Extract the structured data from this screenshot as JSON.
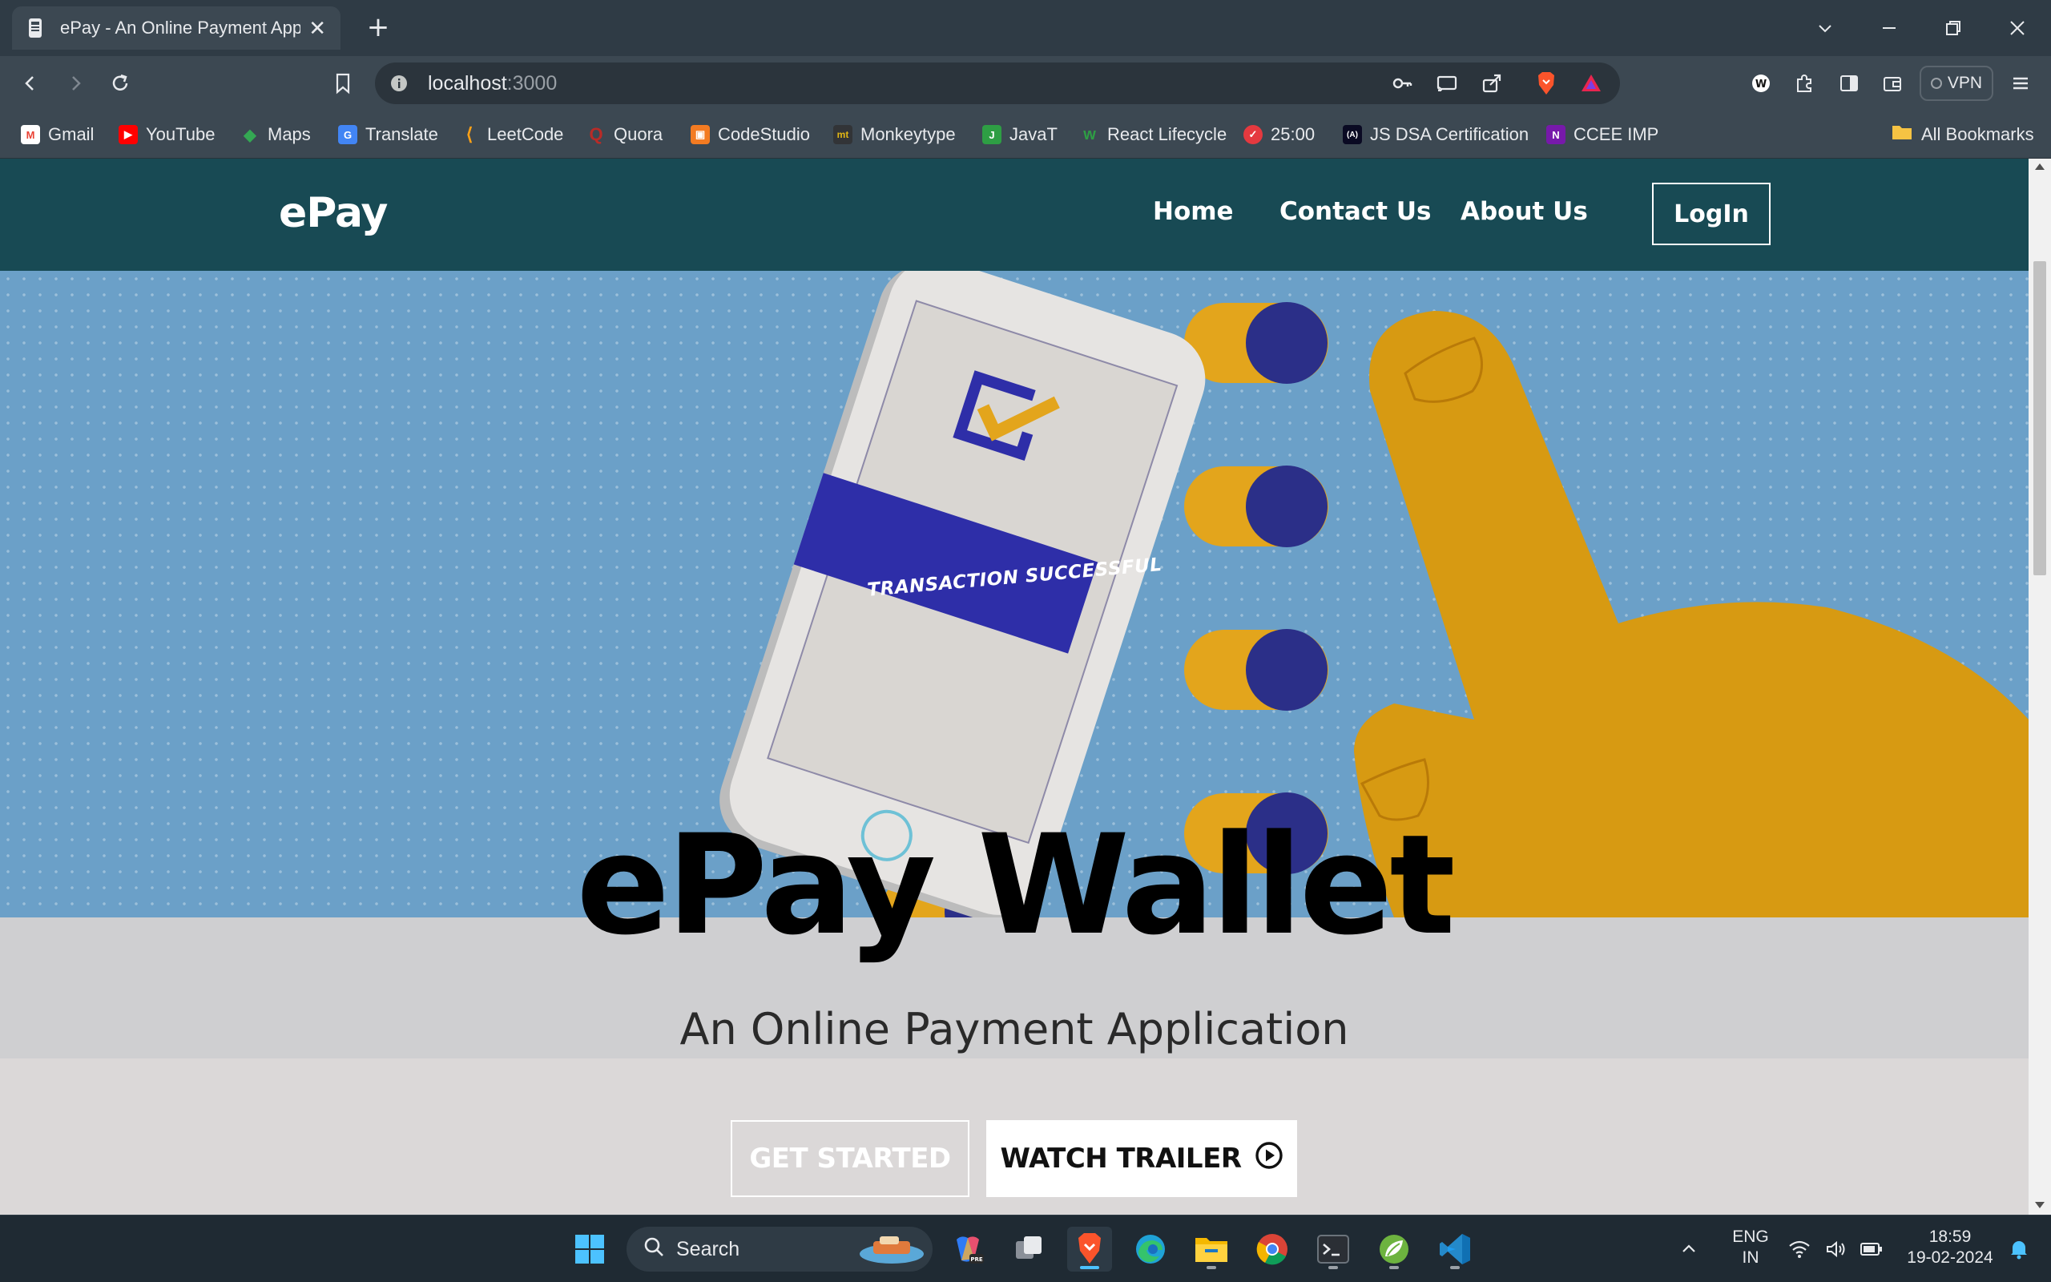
{
  "browser": {
    "tab": {
      "title": "ePay - An Online Payment App",
      "close": "✕"
    },
    "new_tab": "+",
    "url": {
      "host": "localhost",
      "port": ":3000"
    },
    "vpn_label": "VPN"
  },
  "bookmarks": [
    {
      "label": "Gmail",
      "icon": "gmail-icon",
      "color": "#ea4335",
      "glyph": "M"
    },
    {
      "label": "YouTube",
      "icon": "youtube-icon",
      "color": "#ff0000",
      "glyph": "▶"
    },
    {
      "label": "Maps",
      "icon": "maps-icon",
      "color": "#34a853",
      "glyph": "◆"
    },
    {
      "label": "Translate",
      "icon": "translate-icon",
      "color": "#4285f4",
      "glyph": "G"
    },
    {
      "label": "LeetCode",
      "icon": "leetcode-icon",
      "color": "#3c4852",
      "glyph": "⟨"
    },
    {
      "label": "Quora",
      "icon": "quora-icon",
      "color": "#b92b27",
      "glyph": "Q"
    },
    {
      "label": "CodeStudio",
      "icon": "codestudio-icon",
      "color": "#f37b22",
      "glyph": "▣"
    },
    {
      "label": "Monkeytype",
      "icon": "monkeytype-icon",
      "color": "#323437",
      "glyph": "mt"
    },
    {
      "label": "JavaT",
      "icon": "javat-icon",
      "color": "#2e9e44",
      "glyph": "J"
    },
    {
      "label": "React Lifecycle",
      "icon": "react-lifecycle-icon",
      "color": "#3c4852",
      "glyph": "w"
    },
    {
      "label": "25:00",
      "icon": "pomodoro-icon",
      "color": "#e5393f",
      "glyph": "✓"
    },
    {
      "label": "JS DSA Certification",
      "icon": "freecodecamp-icon",
      "color": "#0a0a23",
      "glyph": "(A)"
    },
    {
      "label": "CCEE IMP",
      "icon": "onenote-icon",
      "color": "#7719aa",
      "glyph": "N"
    }
  ],
  "all_bookmarks": "All Bookmarks",
  "site": {
    "brand": "ePay",
    "nav": [
      "Home",
      "Contact Us",
      "About Us"
    ],
    "login": "LogIn",
    "hero_banner_text": "TRANSACTION SUCCESSFUL",
    "title": "ePay Wallet",
    "subtitle": "An Online Payment Application",
    "cta_primary": "GET STARTED",
    "cta_secondary": "WATCH TRAILER",
    "colors": {
      "nav_bg": "#184a54",
      "hero_bg": "#6ba0c8",
      "hand": "#d79a12",
      "dots": "#2b2f88"
    }
  },
  "taskbar": {
    "search_placeholder": "Search",
    "lang_1": "ENG",
    "lang_2": "IN",
    "time": "18:59",
    "date": "19-02-2024"
  }
}
